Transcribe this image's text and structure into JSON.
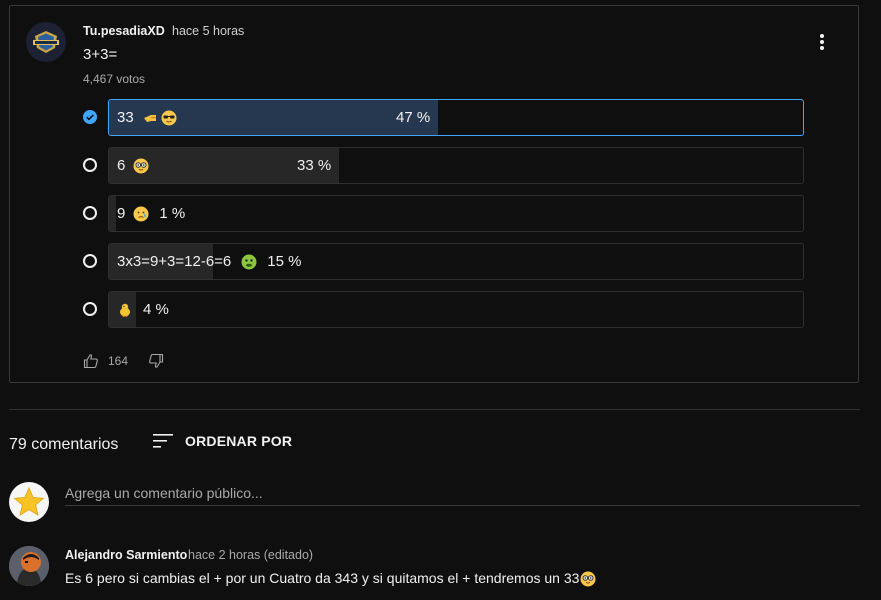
{
  "post": {
    "author": "Tu.pesadiaXD",
    "time": "hace 5 horas",
    "title": "3+3=",
    "votes": "4,467 votos",
    "likes": "164",
    "options": [
      {
        "label": "33",
        "emoji": [
          "backhand-index-icon",
          "sunglasses-face-icon"
        ],
        "percent_text": "47 %",
        "percent": 47,
        "selected": true
      },
      {
        "label": "6",
        "emoji": [
          "nerd-face-icon"
        ],
        "percent_text": "33 %",
        "percent": 33,
        "selected": false
      },
      {
        "label": "9",
        "emoji": [
          "sad-face-icon"
        ],
        "percent_text": "1 %",
        "percent": 1,
        "selected": false
      },
      {
        "label": "3x3=9+3=12-6=6",
        "emoji": [
          "sick-face-icon"
        ],
        "percent_text": "15 %",
        "percent": 15,
        "selected": false
      },
      {
        "label": "",
        "emoji": [
          "chick-icon"
        ],
        "percent_text": "4 %",
        "percent": 4,
        "selected": false
      }
    ]
  },
  "comments_section": {
    "count": "79 comentarios",
    "sort_label": "ORDENAR POR",
    "input_placeholder": "Agrega un comentario público..."
  },
  "comments": [
    {
      "author": "Alejandro Sarmiento",
      "time": "hace 2 horas (editado)",
      "text": "Es 6 pero si cambias el + por un Cuatro da 343 y si quitamos el + tendremos un 33"
    }
  ],
  "colors": {
    "background": "#0f0f0f",
    "accent": "#3ea6ff",
    "selected_fill": "#263850",
    "bar_fill": "#272727"
  }
}
